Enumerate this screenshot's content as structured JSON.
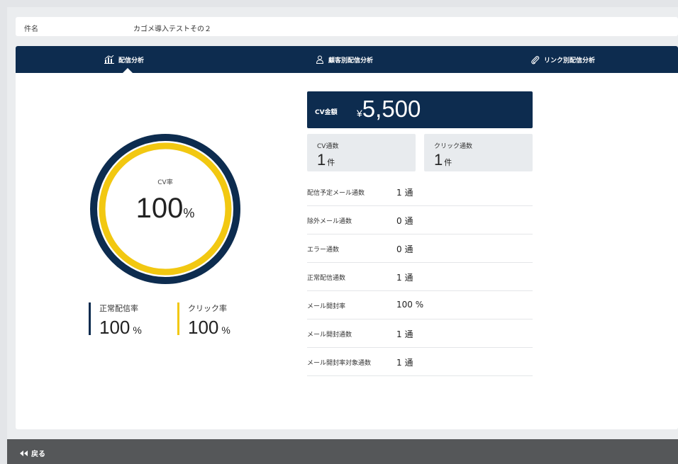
{
  "subject": {
    "label": "件名",
    "value": "カゴメ導入テストその２"
  },
  "tabs": [
    {
      "label": "配信分析",
      "icon": "bar-chart-icon",
      "active": true
    },
    {
      "label": "顧客別配信分析",
      "icon": "user-icon",
      "active": false
    },
    {
      "label": "リンク別配信分析",
      "icon": "paperclip-icon",
      "active": false
    }
  ],
  "cv_rate": {
    "label": "CV率",
    "value": "100",
    "unit": "%",
    "fraction": 1.0
  },
  "rates": {
    "delivery": {
      "label": "正常配信率",
      "value": "100",
      "unit": "%"
    },
    "click": {
      "label": "クリック率",
      "value": "100",
      "unit": "%"
    }
  },
  "cv_amount": {
    "label": "CV金額",
    "currency": "¥",
    "value": "5,500"
  },
  "counts": {
    "cv": {
      "label": "CV通数",
      "value": "1",
      "unit": "件"
    },
    "click": {
      "label": "クリック通数",
      "value": "1",
      "unit": "件"
    }
  },
  "metrics": [
    {
      "label": "配信予定メール通数",
      "value": "1 通"
    },
    {
      "label": "除外メール通数",
      "value": "0 通"
    },
    {
      "label": "エラー通数",
      "value": "0 通"
    },
    {
      "label": "正常配信通数",
      "value": "1 通"
    },
    {
      "label": "メール開封率",
      "value": "100 %"
    },
    {
      "label": "メール開封通数",
      "value": "1 通"
    },
    {
      "label": "メール開封率対象通数",
      "value": "1 通"
    }
  ],
  "footer": {
    "back_label": "戻る",
    "back_icon": "double-left-arrow-icon"
  },
  "colors": {
    "navy": "#0d2c4f",
    "yellow": "#f2c811",
    "footer": "#555759"
  }
}
